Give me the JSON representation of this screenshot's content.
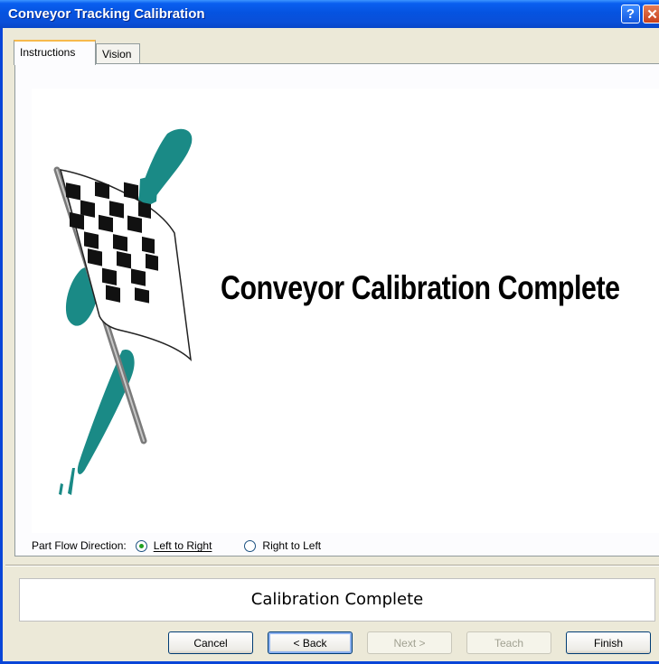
{
  "window": {
    "title": "Conveyor Tracking Calibration",
    "help_label": "?",
    "close_label": "✕"
  },
  "tabs": [
    {
      "label": "Instructions",
      "active": true
    },
    {
      "label": "Vision",
      "active": false
    }
  ],
  "graphic": {
    "headline": "Conveyor Calibration Complete",
    "icon": "checkered-flag-icon",
    "accent_color": "#1a8a86"
  },
  "part_flow": {
    "label": "Part Flow Direction:",
    "options": [
      {
        "label": "Left to Right",
        "selected": true
      },
      {
        "label": "Right to Left",
        "selected": false
      }
    ]
  },
  "status": {
    "text": "Calibration Complete"
  },
  "buttons": {
    "cancel": "Cancel",
    "back": "< Back",
    "next": "Next >",
    "teach": "Teach",
    "finish": "Finish"
  },
  "colors": {
    "titlebar": "#0a5ff0",
    "window_frame": "#0a46d8",
    "dialog_bg": "#ece9d8",
    "radio_dot": "#21a121"
  }
}
